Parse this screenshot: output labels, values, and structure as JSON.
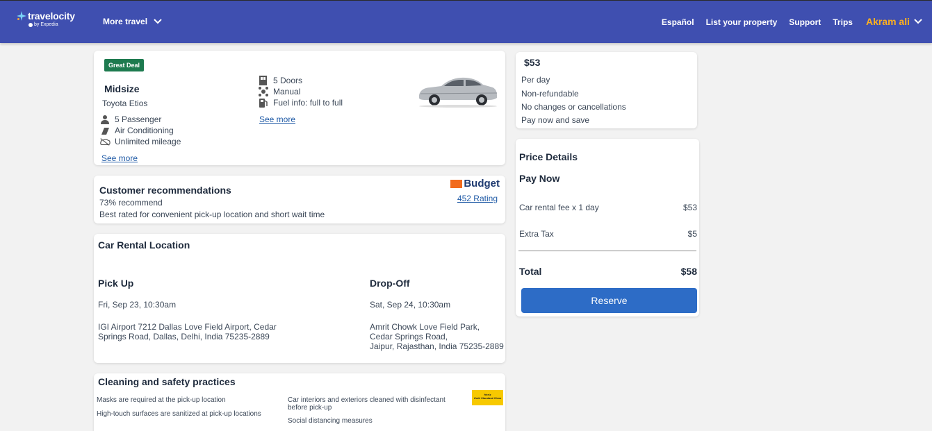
{
  "header": {
    "brand": "travelocity",
    "brand_sub": "by Expedia",
    "more_travel": "More travel",
    "nav": [
      "Español",
      "List your property",
      "Support",
      "Trips"
    ],
    "user": "Akram ali",
    "bg_color": "#3f4fb0",
    "user_color": "#ffb01f"
  },
  "car": {
    "badge": "Great Deal",
    "class": "Midsize",
    "model": "Toyota Etios",
    "features_left": [
      {
        "icon": "person-icon",
        "label": "5 Passenger"
      },
      {
        "icon": "snowflake-icon",
        "label": "Air Conditioning"
      },
      {
        "icon": "mileage-icon",
        "label": "Unlimited mileage"
      }
    ],
    "features_right": [
      {
        "icon": "door-icon",
        "label": "5 Doors"
      },
      {
        "icon": "gear-shift-icon",
        "label": "Manual"
      },
      {
        "icon": "fuel-icon",
        "label": "Fuel info: full to full"
      }
    ],
    "see_more": "See more",
    "see_more_2": "See more"
  },
  "recommendations": {
    "title": "Customer recommendations",
    "percent": "73% recommend",
    "description": "Best rated for convenient pick-up location and short wait time",
    "vendor": "Budget",
    "rating": "452 Rating"
  },
  "location": {
    "title": "Car Rental Location",
    "pickup": {
      "title": "Pick Up",
      "datetime": "Fri, Sep 23, 10:30am",
      "address": [
        "IGI Airport 7212 Dallas Love Field Airport, Cedar",
        "Springs Road, Dallas, Delhi, India 75235-2889"
      ]
    },
    "dropoff": {
      "title": "Drop-Off",
      "datetime": "Sat, Sep 24, 10:30am",
      "address": [
        "Amrit Chowk Love Field Park,",
        "Cedar Springs Road,",
        "Jaipur, Rajasthan, India 75235-2889"
      ]
    }
  },
  "cleaning": {
    "title": "Cleaning and safety practices",
    "items_left": [
      "Masks are required at the pick-up location",
      "High-touch surfaces are sanitized at pick-up locations"
    ],
    "items_right_1": [
      "Car interiors and exteriors cleaned with disinfectant",
      "before pick-up"
    ],
    "items_right_2": "Social distancing measures",
    "hertz_logo": [
      "Hertz",
      "Gold Standard Clean"
    ]
  },
  "price_summary": {
    "price": "$53",
    "lines": [
      "Per day",
      "Non-refundable",
      "No changes or cancellations",
      "Pay now and save"
    ]
  },
  "price_details": {
    "title": "Price Details",
    "pay_now": "Pay Now",
    "rows": [
      {
        "label": "Car rental fee x 1 day",
        "value": "$53"
      },
      {
        "label": "Extra Tax",
        "value": "$5"
      }
    ],
    "total_label": "Total",
    "total_value": "$58",
    "reserve": "Reserve",
    "reserve_color": "#2d6cc6"
  }
}
